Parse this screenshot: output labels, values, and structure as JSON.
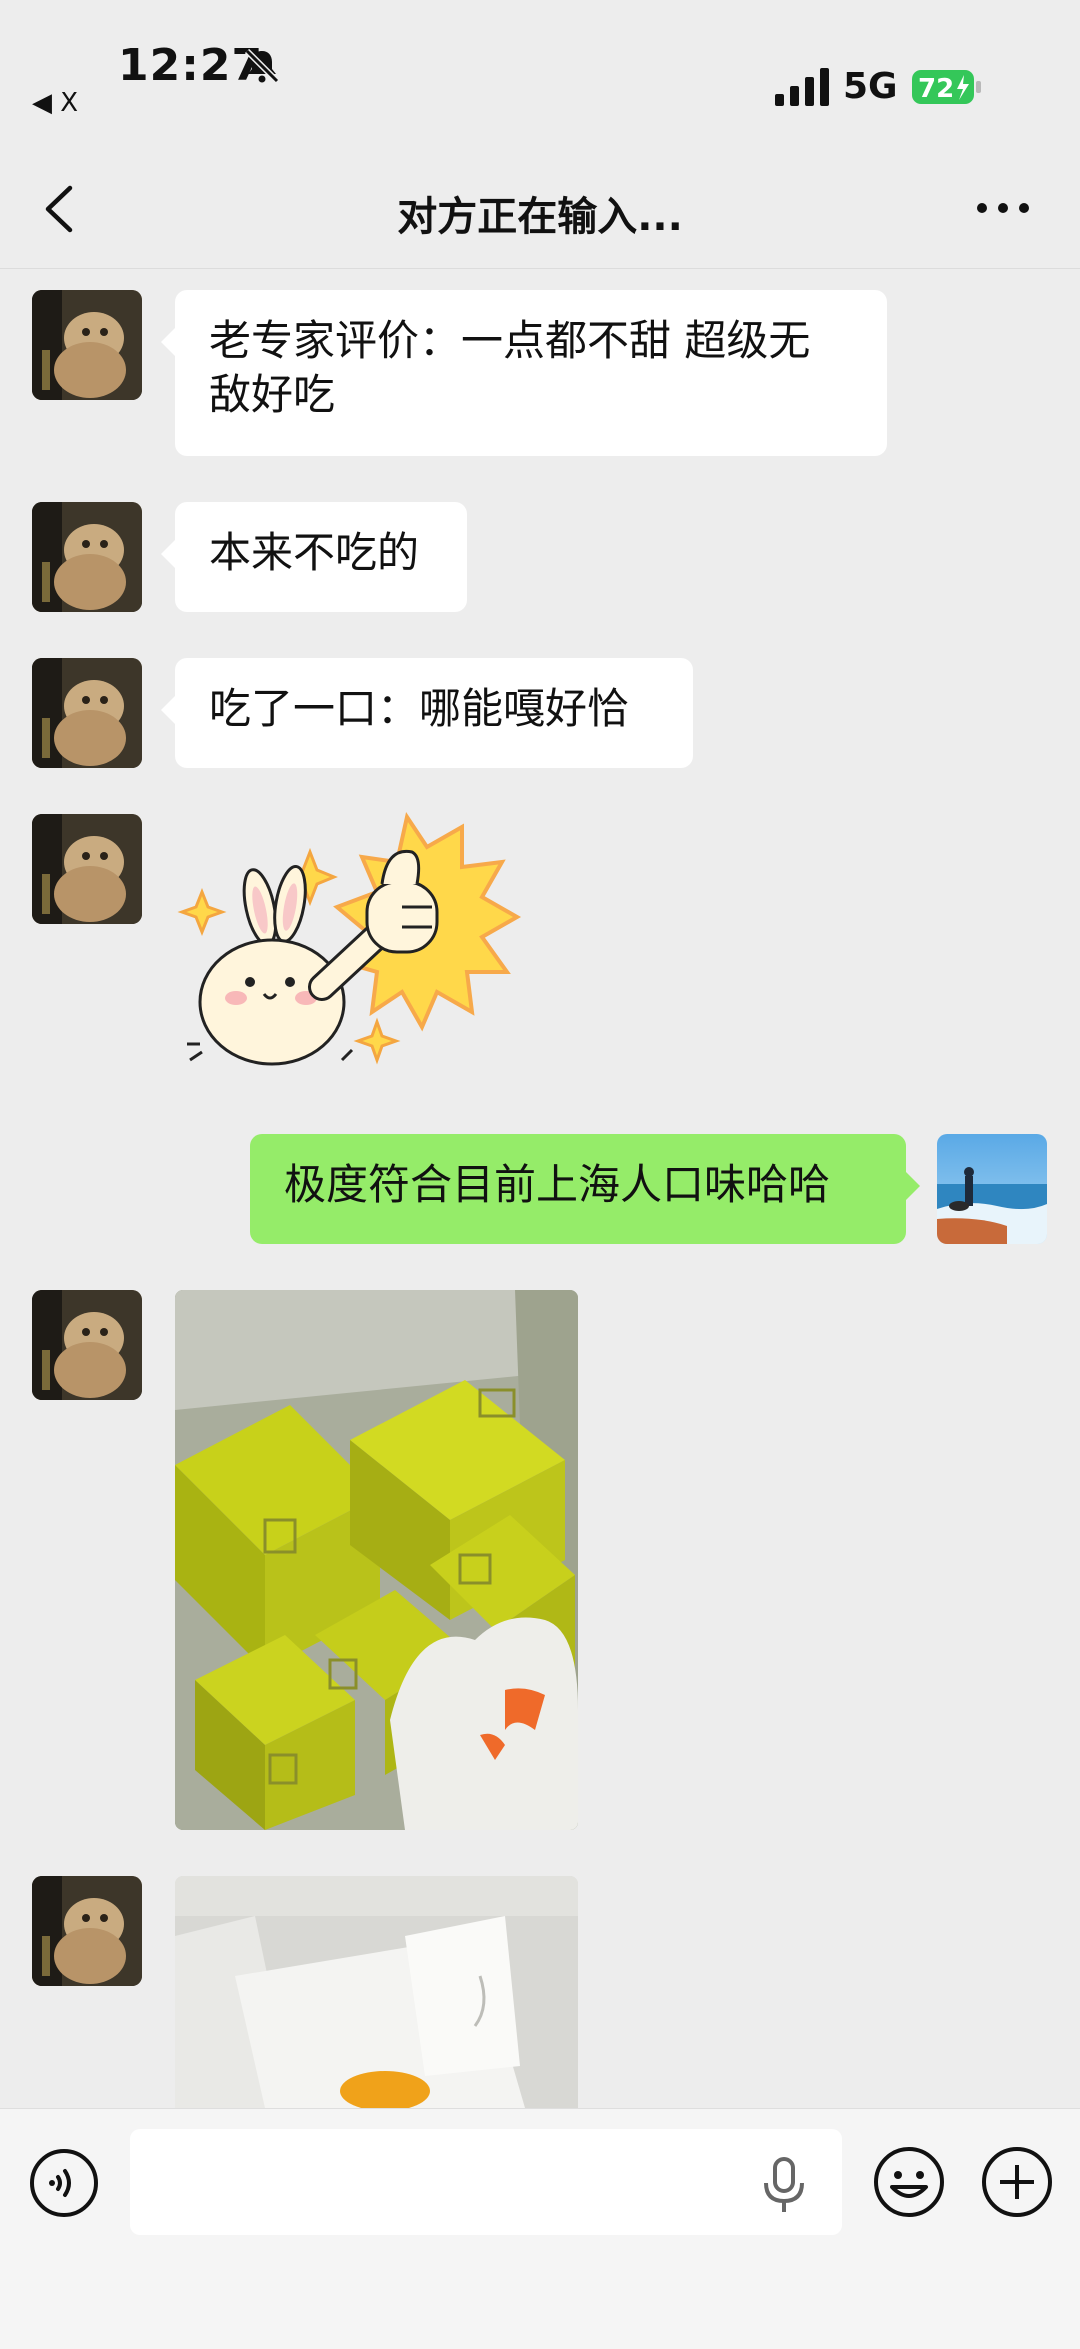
{
  "status_bar": {
    "time": "12:27",
    "back_app": "◀ X",
    "network": "5G",
    "battery": "72"
  },
  "nav": {
    "title": "对方正在输入..."
  },
  "messages": [
    {
      "sender": "other",
      "text_line1": "老专家评价：一点都不甜 超级无",
      "text_line2": "敌好吃"
    },
    {
      "sender": "other",
      "text": "本来不吃的"
    },
    {
      "sender": "other",
      "text": "吃了一口：哪能嘎好恰"
    },
    {
      "sender": "other",
      "type": "sticker",
      "icon": "bunny-thumbs-up-sticker"
    },
    {
      "sender": "me",
      "text": "极度符合目前上海人口味哈哈"
    },
    {
      "sender": "other",
      "type": "image",
      "icon": "green-gift-boxes-photo"
    },
    {
      "sender": "other",
      "type": "image",
      "icon": "opened-box-photo"
    }
  ],
  "input_bar": {
    "placeholder": ""
  },
  "colors": {
    "background": "#ededed",
    "bubble_me": "#95ec69",
    "bubble_other": "#ffffff",
    "battery_fill": "#34c759"
  }
}
